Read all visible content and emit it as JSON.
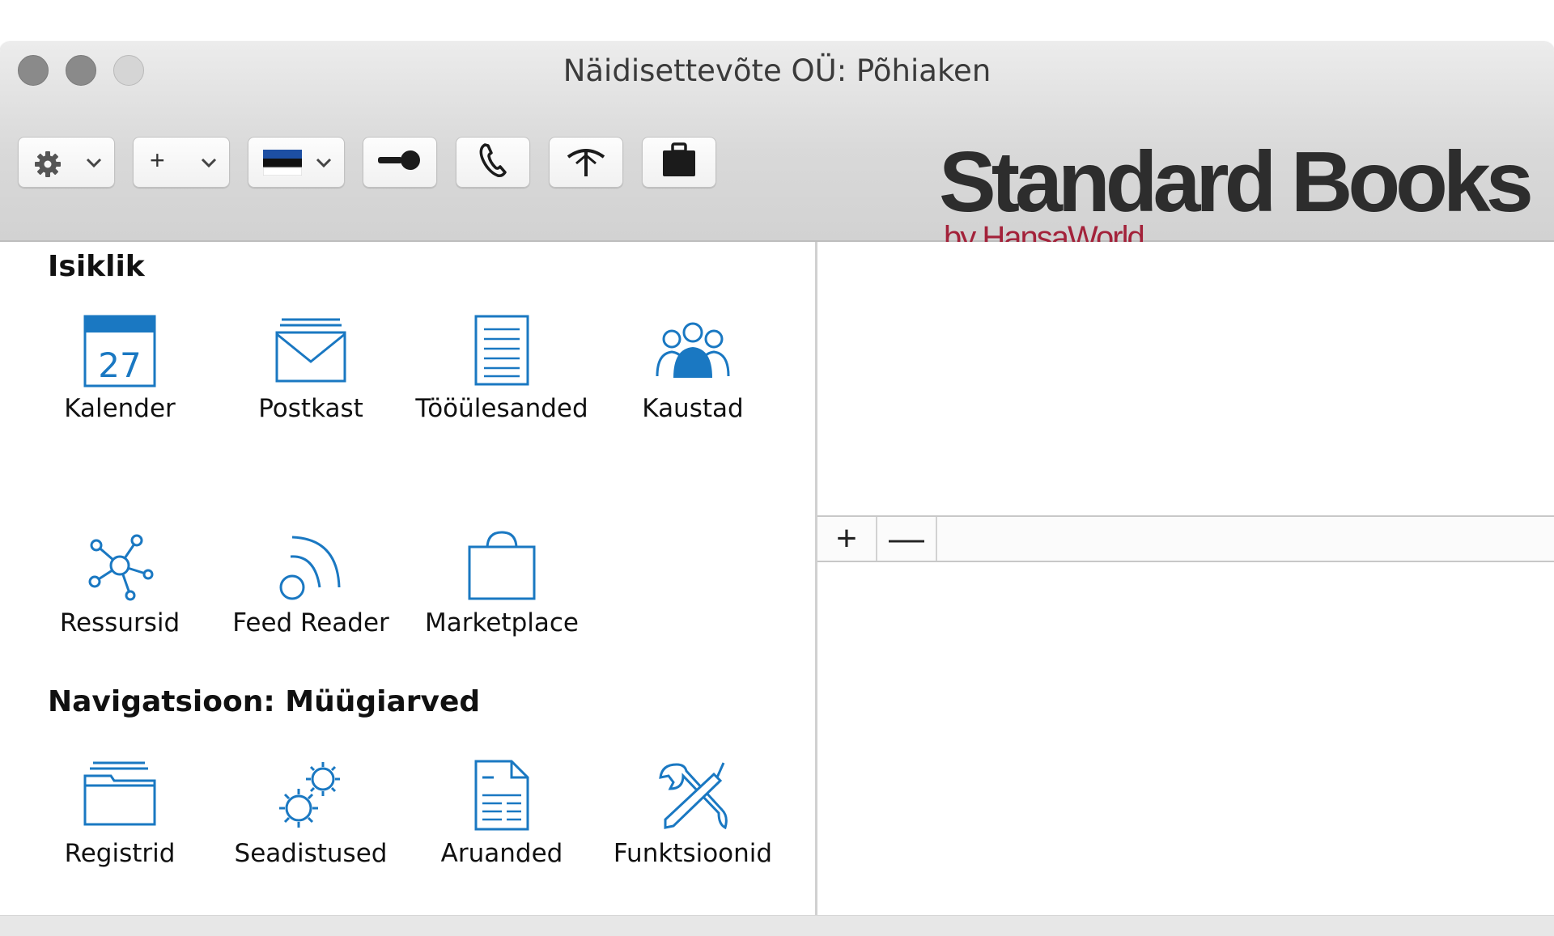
{
  "window": {
    "title": "Näidisettevõte OÜ: Põhiaken"
  },
  "toolbar": {
    "settings_icon": "gear-icon",
    "new_label": "+",
    "language_icon": "estonian-flag-icon",
    "buttons": [
      "key-icon",
      "phone-icon",
      "antenna-icon",
      "briefcase-icon"
    ]
  },
  "brand": {
    "name": "Standard Books",
    "byline": "by HansaWorld",
    "byline_color": "#a3223a"
  },
  "personal": {
    "title": "Isiklik",
    "items": [
      {
        "label": "Kalender",
        "icon": "calendar-icon",
        "day": "27"
      },
      {
        "label": "Postkast",
        "icon": "mailbox-icon"
      },
      {
        "label": "Tööülesanded",
        "icon": "task-list-icon"
      },
      {
        "label": "Kaustad",
        "icon": "people-folders-icon"
      },
      {
        "label": "Ressursid",
        "icon": "resources-network-icon"
      },
      {
        "label": "Feed Reader",
        "icon": "rss-feed-icon"
      },
      {
        "label": "Marketplace",
        "icon": "shopping-bag-icon"
      }
    ]
  },
  "navigation": {
    "title": "Navigatsioon: Müügiarved",
    "items": [
      {
        "label": "Registrid",
        "icon": "folder-registers-icon"
      },
      {
        "label": "Seadistused",
        "icon": "settings-gears-icon"
      },
      {
        "label": "Aruanded",
        "icon": "report-document-icon"
      },
      {
        "label": "Funktsioonid",
        "icon": "tools-icon"
      }
    ]
  },
  "right_panel": {
    "add_label": "+",
    "remove_label": "—"
  },
  "colors": {
    "icon_blue": "#1a78c2",
    "titlebar": "#dcdcdc"
  }
}
